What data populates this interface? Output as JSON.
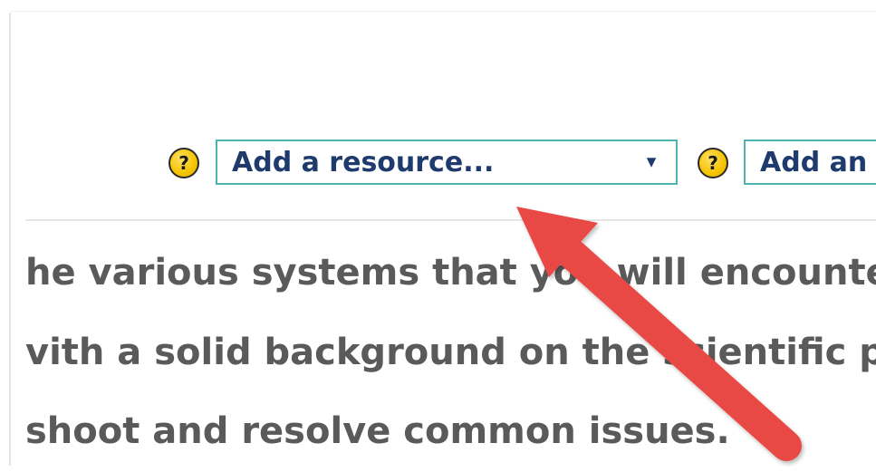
{
  "toolbar": {
    "help_icon_glyph": "?",
    "resource_select": {
      "selected": "Add a resource...",
      "arrow": "▼"
    },
    "second_select": {
      "selected": "Add an"
    }
  },
  "content": {
    "lines": [
      "he various systems that you will encounter w",
      "vith a solid background on the scientific prin",
      "shoot and resolve common issues."
    ]
  },
  "annotation": {
    "arrow_color": "#e84a45"
  },
  "colors": {
    "select_border": "#4fb3b0",
    "select_text": "#1f3b6e",
    "body_text": "#5a5a5a",
    "help_icon_fill": "#f5c400"
  }
}
